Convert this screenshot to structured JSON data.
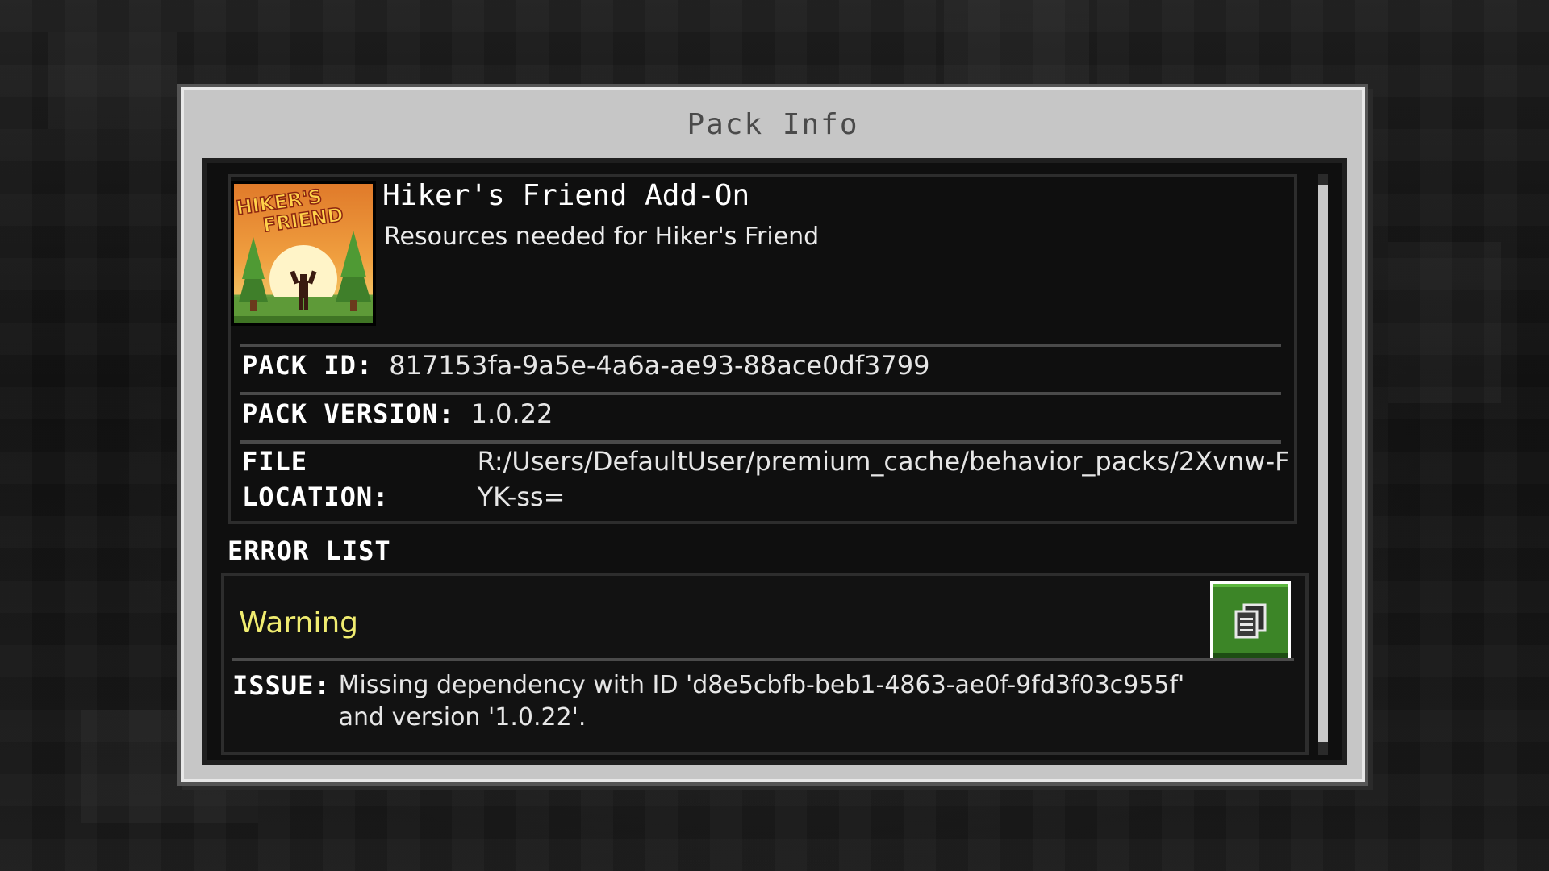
{
  "dialog": {
    "title": "Pack Info"
  },
  "pack": {
    "icon_text_line1": "HIKER'S",
    "icon_text_line2": "FRIEND",
    "title": "Hiker's Friend Add-On",
    "description": "Resources needed for Hiker's Friend",
    "id_label": "PACK ID:",
    "id_value": "817153fa-9a5e-4a6a-ae93-88ace0df3799",
    "version_label": "PACK VERSION:",
    "version_value": "1.0.22",
    "location_label": "FILE LOCATION:",
    "location_value": "R:/Users/DefaultUser/premium_cache/behavior_packs/2Xvnw-FYK-ss="
  },
  "errors": {
    "heading": "ERROR LIST",
    "items": [
      {
        "severity": "Warning",
        "issue_label": "ISSUE:",
        "issue_text": "Missing dependency with ID 'd8e5cbfb-beb1-4863-ae0f-9fd3f03c955f' and version '1.0.22'.",
        "copy_icon": "copy-icon"
      }
    ]
  },
  "colors": {
    "warning": "#f0ec70",
    "copy_button": "#3c8527"
  }
}
